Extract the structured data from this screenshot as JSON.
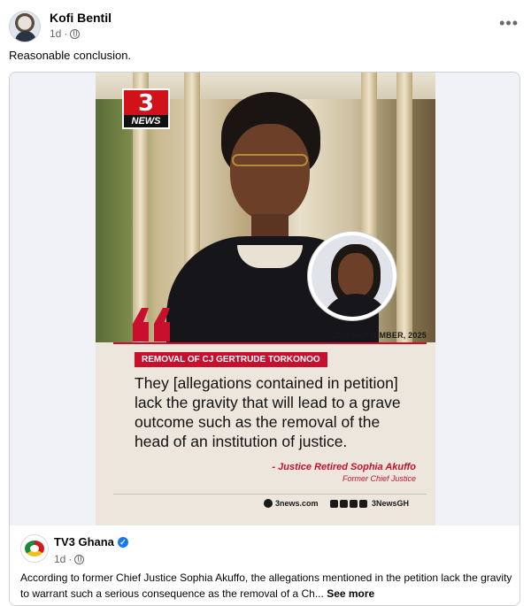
{
  "post": {
    "author": "Kofi Bentil",
    "time": "1d",
    "separator": "·",
    "text": "Reasonable conclusion.",
    "more_icon": "more-dots-icon"
  },
  "graphic": {
    "logo_number": "3",
    "logo_text": "NEWS",
    "date": "2ND SEPTEMBER, 2025",
    "tag": "REMOVAL OF CJ GERTRUDE TORKONOO",
    "quote": "They [allegations contained in petition] lack the gravity that will lead to a grave outcome such as the removal of the head of an institution of justice.",
    "attribution_name": "- Justice Retired Sophia Akuffo",
    "attribution_role": "Former Chief Justice",
    "site": "3news.com",
    "handle": "3NewsGH",
    "accent_color": "#c8102e"
  },
  "source": {
    "name": "TV3 Ghana",
    "time": "1d",
    "separator": "·",
    "body": "According to former Chief Justice Sophia Akuffo, the allegations mentioned in the petition lack the gravity to warrant such a serious consequence as the removal of a Ch...",
    "see_more": "See more"
  }
}
